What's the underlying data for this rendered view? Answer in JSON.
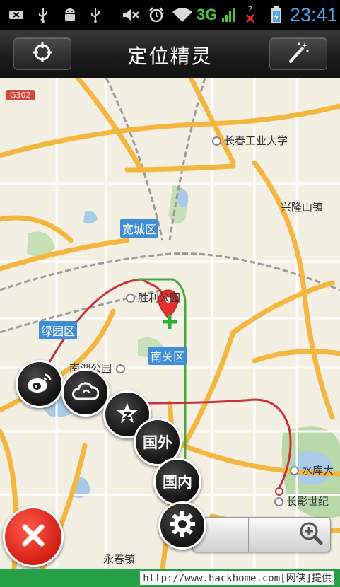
{
  "status_bar": {
    "network_type": "3G",
    "time": "23:41",
    "sim_badge": "2",
    "icons": [
      "usb-debug-icon",
      "usb-icon",
      "android-debug-icon",
      "usb-icon",
      "mute-icon",
      "alarm-icon",
      "wifi-icon",
      "signal-icon",
      "no-sim-icon",
      "battery-charging-icon"
    ]
  },
  "header": {
    "title": "定位精灵",
    "left_button_icon": "crosshair-icon",
    "right_button_icon": "magic-wand-icon"
  },
  "map": {
    "road_tag": "G302",
    "labels": {
      "changchun_univ": "长春工业大学",
      "xinglong": "兴隆山镇",
      "shengli_park": "胜利公园",
      "nanhu_park": "南湖公园",
      "shuiku": "水库大",
      "changying": "长影世纪",
      "yongchun": "永春镇"
    },
    "districts": {
      "kuancheng": "宽城区",
      "lvyuan": "绿园区",
      "nanguan": "南关区"
    }
  },
  "menu": {
    "weibo_icon": "weibo-icon",
    "weather_icon": "cloud-icon",
    "favorite_icon": "star-icon",
    "abroad_label": "国外",
    "domestic_label": "国内",
    "settings_icon": "gear-icon",
    "close_icon": "close-icon",
    "zoom_in_icon": "zoom-in-icon"
  },
  "footer": {
    "text": "http://www.hackhome.com[网侠]提供"
  },
  "colors": {
    "status_time": "#4fa4e8",
    "status_3g": "#4cc934",
    "header_bg": "#1f1f1f",
    "map_bg": "#f3efe3",
    "major_road": "#f3b63f",
    "district_badge": "#3d8ed6",
    "close_button": "#d21f14",
    "marker": "#e8312a",
    "footer_bg": "#26a046"
  }
}
